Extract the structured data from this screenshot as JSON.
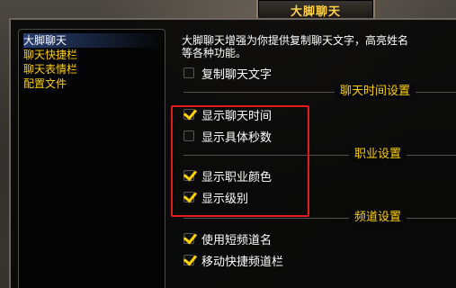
{
  "window": {
    "title": "大脚聊天"
  },
  "sidebar": {
    "items": [
      {
        "label": "大脚聊天"
      },
      {
        "label": "聊天快捷栏"
      },
      {
        "label": "聊天表情栏"
      },
      {
        "label": "配置文件"
      }
    ]
  },
  "main": {
    "description_line1": "大脚聊天增强为你提供复制聊天文字，高亮姓名",
    "description_line2": "等各种功能。",
    "options": {
      "copy_chat": {
        "label": "复制聊天文字",
        "checked": false
      },
      "show_time": {
        "label": "显示聊天时间",
        "checked": true
      },
      "show_seconds": {
        "label": "显示具体秒数",
        "checked": false
      },
      "class_color": {
        "label": "显示职业颜色",
        "checked": true
      },
      "show_level": {
        "label": "显示级别",
        "checked": true
      },
      "short_channel": {
        "label": "使用短频道名",
        "checked": true
      },
      "move_channel_bar": {
        "label": "移动快捷频道栏",
        "checked": true
      }
    },
    "sections": {
      "time": "聊天时间设置",
      "class": "职业设置",
      "channel": "频道设置"
    }
  },
  "colors": {
    "accent": "#ffd100",
    "highlight_box": "#e21b1b"
  }
}
